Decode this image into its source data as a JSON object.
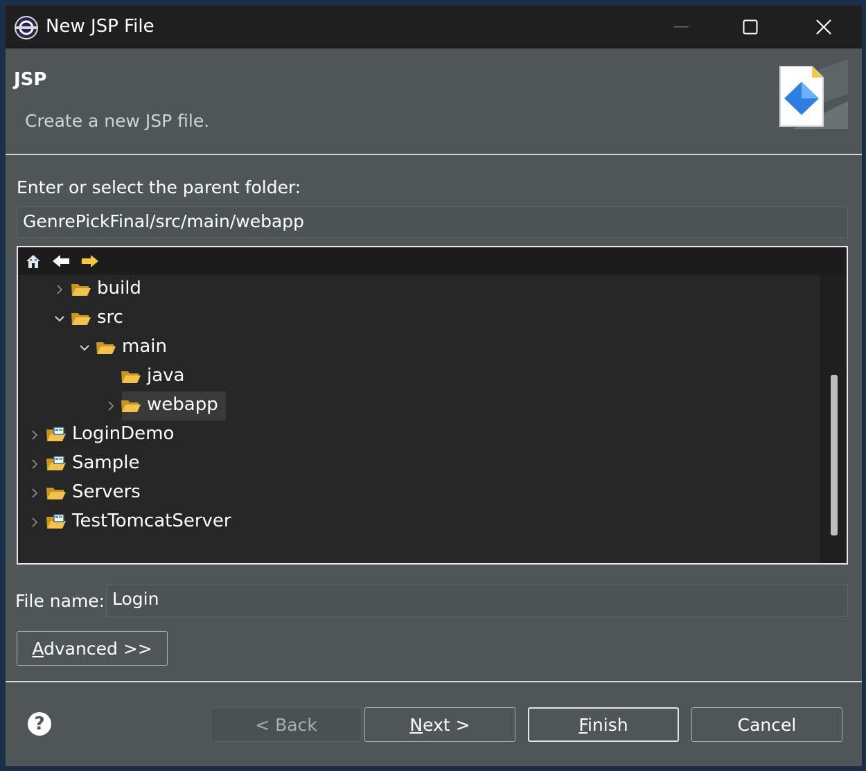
{
  "window": {
    "title": "New JSP File",
    "controls": {
      "minimize": "minimize",
      "maximize": "maximize",
      "close": "close"
    }
  },
  "header": {
    "title": "JSP",
    "description": "Create a new JSP file."
  },
  "folder": {
    "label": "Enter or select the parent folder:",
    "value": "GenrePickFinal/src/main/webapp"
  },
  "tree": {
    "nav_icons": [
      "home-icon",
      "back-arrow-icon",
      "forward-arrow-icon"
    ],
    "rows": [
      {
        "label": "build",
        "icon": "folder-icon",
        "state": "collapsed"
      },
      {
        "label": "src",
        "icon": "folder-icon",
        "state": "expanded"
      },
      {
        "label": "main",
        "icon": "folder-icon",
        "state": "expanded"
      },
      {
        "label": "java",
        "icon": "folder-icon",
        "state": "leaf"
      },
      {
        "label": "webapp",
        "icon": "folder-icon",
        "state": "collapsed",
        "selected": true
      },
      {
        "label": "LoginDemo",
        "icon": "project-icon",
        "state": "collapsed"
      },
      {
        "label": "Sample",
        "icon": "project-icon",
        "state": "collapsed"
      },
      {
        "label": "Servers",
        "icon": "folder-icon",
        "state": "collapsed"
      },
      {
        "label": "TestTomcatServer",
        "icon": "project-icon",
        "state": "collapsed"
      }
    ]
  },
  "file": {
    "label": "File name:",
    "value": "Login"
  },
  "advanced": {
    "mnemonic": "A",
    "rest": "dvanced >>"
  },
  "footer": {
    "help_icon": "?",
    "back": "< Back",
    "next": {
      "mnemonic": "N",
      "rest": "ext >"
    },
    "finish": {
      "mnemonic": "F",
      "rest": "inish"
    },
    "cancel": "Cancel"
  },
  "colors": {
    "dialog_bg": "#4f5658",
    "titlebar_bg": "#1f1f1f",
    "tree_bg": "#262626",
    "folder_yellow": "#e8b83a"
  }
}
